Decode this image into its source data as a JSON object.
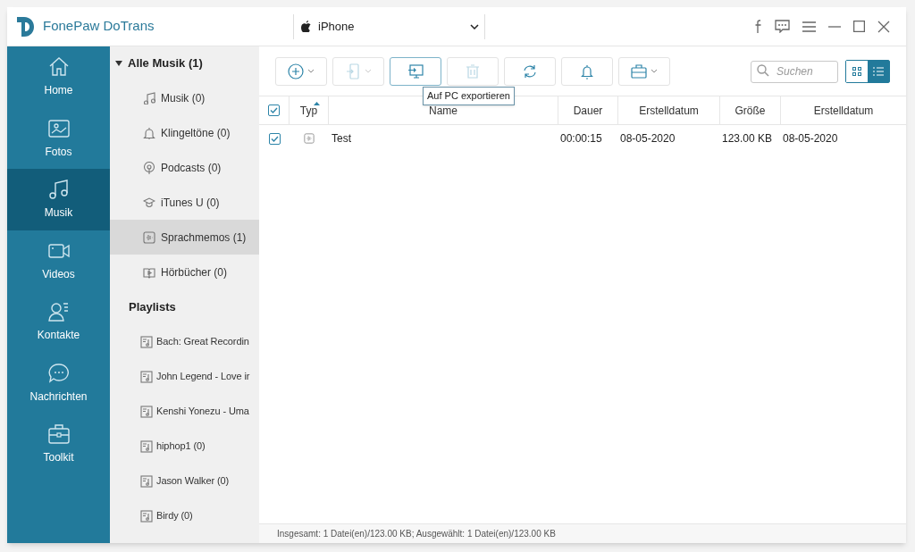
{
  "app": {
    "title": "FonePaw DoTrans",
    "device": "iPhone"
  },
  "nav": [
    {
      "kind": "home",
      "label": "Home",
      "selected": false
    },
    {
      "kind": "photo",
      "label": "Fotos",
      "selected": false
    },
    {
      "kind": "music",
      "label": "Musik",
      "selected": true
    },
    {
      "kind": "video",
      "label": "Videos",
      "selected": false
    },
    {
      "kind": "contact",
      "label": "Kontakte",
      "selected": false
    },
    {
      "kind": "message",
      "label": "Nachrichten",
      "selected": false
    },
    {
      "kind": "toolkit",
      "label": "Toolkit",
      "selected": false
    }
  ],
  "library": {
    "title": "Alle Musik (1)",
    "expanded": true,
    "items": [
      {
        "kind": "music",
        "label": "Musik (0)",
        "selected": false
      },
      {
        "kind": "bell",
        "label": "Klingeltöne (0)",
        "selected": false
      },
      {
        "kind": "podcast",
        "label": "Podcasts (0)",
        "selected": false
      },
      {
        "kind": "cap",
        "label": "iTunes U (0)",
        "selected": false
      },
      {
        "kind": "memo",
        "label": "Sprachmemos (1)",
        "selected": true
      },
      {
        "kind": "book",
        "label": "Hörbücher (0)",
        "selected": false
      }
    ]
  },
  "playlists": {
    "title": "Playlists",
    "items": [
      {
        "label": "Bach: Great Recordin",
        "selected": false
      },
      {
        "label": "John Legend - Love ir",
        "selected": false
      },
      {
        "label": "Kenshi Yonezu - Uma",
        "selected": false
      },
      {
        "label": "hiphop1 (0)",
        "selected": false
      },
      {
        "label": "Jason Walker (0)",
        "selected": false
      },
      {
        "label": "Birdy (0)",
        "selected": false
      }
    ]
  },
  "toolbar": [
    {
      "kind": "add",
      "dropdown": true,
      "disabled": false,
      "highlighted": false
    },
    {
      "kind": "to-device",
      "dropdown": true,
      "disabled": true,
      "highlighted": false
    },
    {
      "kind": "to-pc",
      "dropdown": false,
      "disabled": false,
      "highlighted": true
    },
    {
      "kind": "delete",
      "dropdown": false,
      "disabled": true,
      "highlighted": false
    },
    {
      "kind": "sync",
      "dropdown": false,
      "disabled": false,
      "highlighted": false
    },
    {
      "kind": "ringtone",
      "dropdown": false,
      "disabled": false,
      "highlighted": false
    },
    {
      "kind": "toolkit",
      "dropdown": true,
      "disabled": false,
      "highlighted": false
    }
  ],
  "tooltip": "Auf PC exportieren",
  "search": {
    "placeholder": "Suchen"
  },
  "view_toggle": [
    {
      "kind": "grid",
      "selected": false
    },
    {
      "kind": "list",
      "selected": true
    }
  ],
  "table": {
    "all_checked": true,
    "type_column": {
      "label": "Typ",
      "sorted": true
    },
    "columns": [
      {
        "label": "Name",
        "sorted": false
      },
      {
        "label": "Dauer",
        "sorted": false
      },
      {
        "label": "Erstelldatum",
        "sorted": false
      },
      {
        "label": "Größe",
        "sorted": false
      },
      {
        "label": "Erstelldatum",
        "sorted": false
      }
    ],
    "rows": [
      {
        "checked": true,
        "cells": [
          "Test",
          "00:00:15",
          "08-05-2020",
          "123.00 KB",
          "08-05-2020"
        ]
      }
    ]
  },
  "status_bar": "Insgesamt: 1 Datei(en)/123.00 KB; Ausgewählt: 1 Datei(en)/123.00 KB"
}
